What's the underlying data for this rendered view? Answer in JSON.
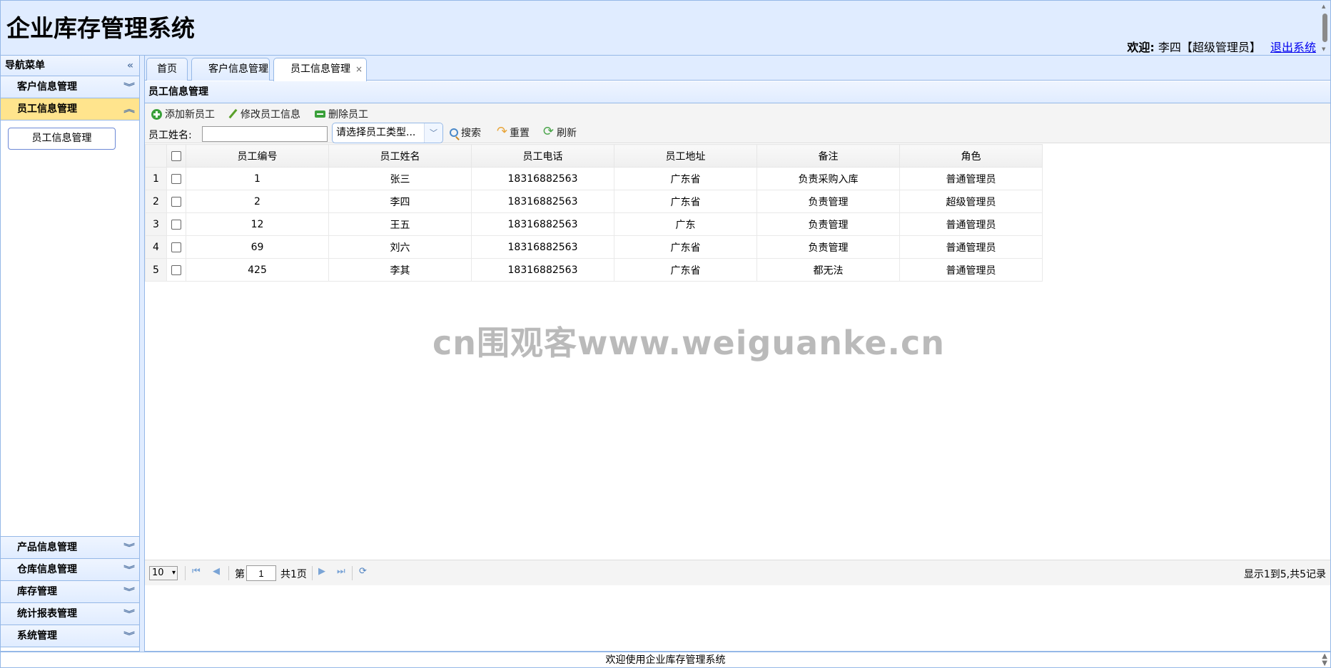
{
  "app_title": "企业库存管理系统",
  "header": {
    "welcome_label": "欢迎:",
    "user": "李四【超级管理员】",
    "logout": "退出系统"
  },
  "sidebar": {
    "title": "导航菜单",
    "collapse_icon": "double-chevron-left",
    "sections": [
      {
        "label": "客户信息管理"
      },
      {
        "label": "员工信息管理",
        "active": true,
        "items": [
          "员工信息管理"
        ]
      },
      {
        "label": "产品信息管理"
      },
      {
        "label": "仓库信息管理"
      },
      {
        "label": "库存管理"
      },
      {
        "label": "统计报表管理"
      },
      {
        "label": "系统管理"
      }
    ]
  },
  "tabs": [
    {
      "label": "首页"
    },
    {
      "label": "客户信息管理",
      "closable": true
    },
    {
      "label": "员工信息管理",
      "closable": true,
      "selected": true
    }
  ],
  "panel": {
    "title": "员工信息管理",
    "toolbar": {
      "add": "添加新员工",
      "edit": "修改员工信息",
      "delete": "删除员工"
    },
    "search": {
      "name_label": "员工姓名:",
      "name_value": "",
      "type_placeholder": "请选择员工类型...",
      "search": "搜索",
      "reset": "重置",
      "refresh": "刷新"
    }
  },
  "grid": {
    "columns": [
      "员工编号",
      "员工姓名",
      "员工电话",
      "员工地址",
      "备注",
      "角色"
    ],
    "rows": [
      {
        "n": "1",
        "cells": [
          "1",
          "张三",
          "18316882563",
          "广东省",
          "负责采购入库",
          "普通管理员"
        ]
      },
      {
        "n": "2",
        "cells": [
          "2",
          "李四",
          "18316882563",
          "广东省",
          "负责管理",
          "超级管理员"
        ]
      },
      {
        "n": "3",
        "cells": [
          "12",
          "王五",
          "18316882563",
          "广东",
          "负责管理",
          "普通管理员"
        ]
      },
      {
        "n": "4",
        "cells": [
          "69",
          "刘六",
          "18316882563",
          "广东省",
          "负责管理",
          "普通管理员"
        ]
      },
      {
        "n": "5",
        "cells": [
          "425",
          "李其",
          "18316882563",
          "广东省",
          "都无法",
          "普通管理员"
        ]
      }
    ]
  },
  "watermark": "cn围观客www.weiguanke.cn",
  "pager": {
    "page_size": "10",
    "page_prefix": "第",
    "page": "1",
    "page_total": "共1页",
    "info": "显示1到5,共5记录"
  },
  "footer": "欢迎使用企业库存管理系统",
  "colors": {
    "header_bg": "#e0ecff",
    "border": "#95b8e7",
    "active_section": "#ffe48d",
    "link": "#0000ee"
  }
}
